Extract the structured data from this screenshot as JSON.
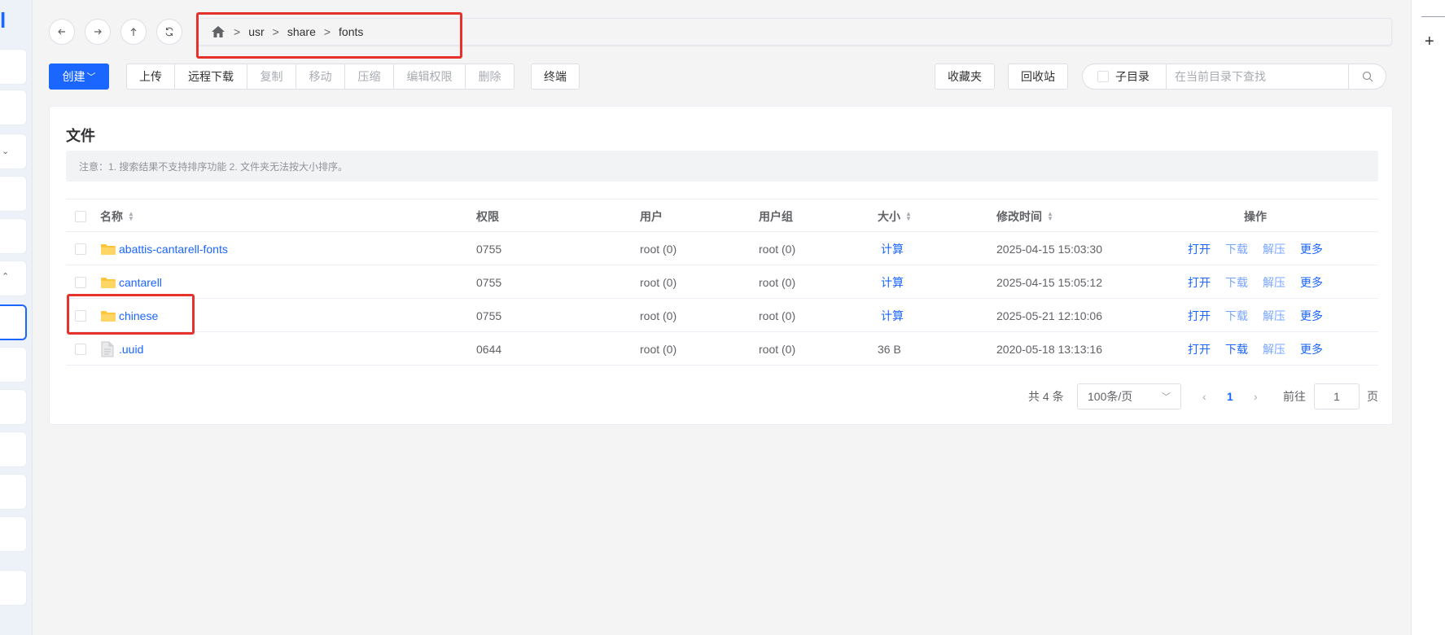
{
  "nav": {
    "back_icon": "arrow-left-icon",
    "forward_icon": "arrow-right-icon",
    "up_icon": "arrow-up-icon",
    "refresh_icon": "refresh-icon"
  },
  "breadcrumb": {
    "home_icon": "home-icon",
    "separator": ">",
    "items": [
      "usr",
      "share",
      "fonts"
    ]
  },
  "toolbar": {
    "create_label": "创建",
    "group_buttons": [
      "上传",
      "远程下载",
      "复制",
      "移动",
      "压缩",
      "编辑权限",
      "删除"
    ],
    "terminal_label": "终端",
    "favorites_label": "收藏夹",
    "recycle_label": "回收站",
    "subdir_label": "子目录",
    "search_placeholder": "在当前目录下查找"
  },
  "panel": {
    "title": "文件",
    "notice": "注意：1. 搜索结果不支持排序功能 2. 文件夹无法按大小排序。"
  },
  "table": {
    "headers": {
      "name": "名称",
      "permission": "权限",
      "user": "用户",
      "group": "用户组",
      "size": "大小",
      "modified": "修改时间",
      "actions": "操作"
    },
    "rows": [
      {
        "name": "abattis-cantarell-fonts",
        "type": "folder",
        "permission": "0755",
        "user": "root (0)",
        "group": "root (0)",
        "size": "计算",
        "modified": "2025-04-15 15:03:30",
        "open": "打开",
        "download": "下载",
        "extract": "解压",
        "more": "更多"
      },
      {
        "name": "cantarell",
        "type": "folder",
        "permission": "0755",
        "user": "root (0)",
        "group": "root (0)",
        "size": "计算",
        "modified": "2025-04-15 15:05:12",
        "open": "打开",
        "download": "下载",
        "extract": "解压",
        "more": "更多"
      },
      {
        "name": "chinese",
        "type": "folder",
        "permission": "0755",
        "user": "root (0)",
        "group": "root (0)",
        "size": "计算",
        "modified": "2025-05-21 12:10:06",
        "open": "打开",
        "download": "下载",
        "extract": "解压",
        "more": "更多"
      },
      {
        "name": ".uuid",
        "type": "file",
        "permission": "0644",
        "user": "root (0)",
        "group": "root (0)",
        "size": "36 B",
        "modified": "2020-05-18 13:13:16",
        "open": "打开",
        "download": "下载",
        "extract": "解压",
        "more": "更多"
      }
    ]
  },
  "pagination": {
    "total": "共 4 条",
    "page_size": "100条/页",
    "current_page": "1",
    "goto_label": "前往",
    "goto_value": "1",
    "page_suffix": "页"
  },
  "colors": {
    "accent": "#1a66ff",
    "highlight": "#e5322d",
    "folder": "#ffc53d"
  }
}
